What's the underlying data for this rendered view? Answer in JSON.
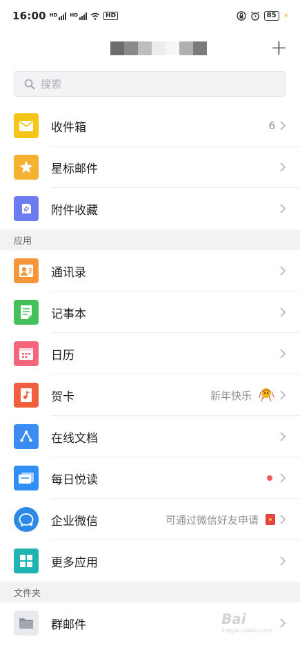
{
  "status_bar": {
    "time": "16:00",
    "battery": "85"
  },
  "header": {
    "add_button": "+"
  },
  "search": {
    "placeholder": "搜索"
  },
  "mail_items": [
    {
      "label": "收件箱",
      "count": "6",
      "icon": "inbox-icon",
      "color": "#f5c518"
    },
    {
      "label": "星标邮件",
      "icon": "star-icon",
      "color": "#f6b130"
    },
    {
      "label": "附件收藏",
      "icon": "attachment-icon",
      "color": "#6b7cf1"
    }
  ],
  "sections": {
    "apps": "应用",
    "folders": "文件夹"
  },
  "app_items": [
    {
      "label": "通讯录",
      "icon": "contacts-icon",
      "color": "#f6953a"
    },
    {
      "label": "记事本",
      "icon": "notepad-icon",
      "color": "#45c05a"
    },
    {
      "label": "日历",
      "icon": "calendar-icon",
      "color": "#f4667a"
    },
    {
      "label": "贺卡",
      "trailing": "新年快乐",
      "icon": "greeting-card-icon",
      "color": "#f0603e"
    },
    {
      "label": "在线文档",
      "icon": "online-docs-icon",
      "color": "#3b8bf0"
    },
    {
      "label": "每日悦读",
      "icon": "daily-reading-icon",
      "color": "#2f8ff6"
    },
    {
      "label": "企业微信",
      "trailing": "可通过微信好友申请",
      "icon": "wecom-icon",
      "color": "#2d8ae8"
    },
    {
      "label": "更多应用",
      "icon": "more-apps-icon",
      "color": "#1fb4b1"
    }
  ],
  "folder_items": [
    {
      "label": "群邮件",
      "icon": "folder-icon",
      "color": "#e8eaed"
    }
  ],
  "watermark": {
    "text": "Bai",
    "sub": "jingyan.baidu.com"
  }
}
